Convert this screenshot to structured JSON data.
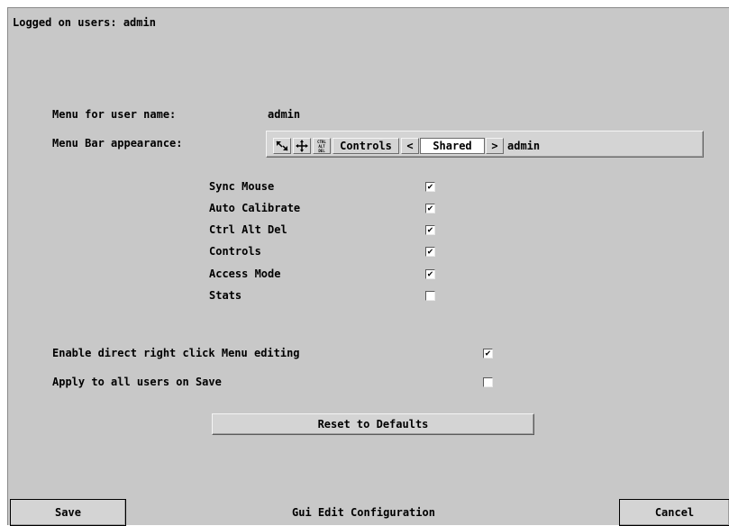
{
  "header": {
    "logged_on": "Logged on users: admin"
  },
  "menu_for": {
    "label": "Menu for user name:",
    "value": "admin"
  },
  "menu_bar": {
    "label": "Menu Bar appearance:",
    "icons": [
      "resize-corner-icon",
      "move-cross-icon",
      "ctrl-alt-del-icon"
    ],
    "ctrl_alt_del_glyph": "CTRL ALT DEL",
    "controls_label": "Controls",
    "left_arrow": "<",
    "mode_label": "Shared",
    "right_arrow": ">",
    "user": "admin"
  },
  "options": [
    {
      "label": "Sync Mouse",
      "checked": true
    },
    {
      "label": "Auto Calibrate",
      "checked": true
    },
    {
      "label": "Ctrl Alt Del",
      "checked": true
    },
    {
      "label": "Controls",
      "checked": true
    },
    {
      "label": "Access Mode",
      "checked": true
    },
    {
      "label": "Stats",
      "checked": false
    }
  ],
  "settings": [
    {
      "label": "Enable direct right click Menu editing",
      "checked": true
    },
    {
      "label": "Apply to all users on Save",
      "checked": false
    }
  ],
  "reset_button": "Reset to Defaults",
  "footer": {
    "save": "Save",
    "title": "Gui Edit Configuration",
    "cancel": "Cancel"
  },
  "check_mark": "✔"
}
